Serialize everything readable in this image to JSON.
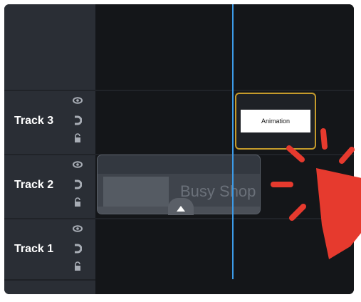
{
  "tracks": [
    {
      "label": "Track 3"
    },
    {
      "label": "Track 2"
    },
    {
      "label": "Track 1"
    }
  ],
  "media_clip": {
    "title": "Busy Shop"
  },
  "animation_clip": {
    "title": "Animation"
  },
  "colors": {
    "panel_bg": "#141619",
    "header_bg": "#2a2e35",
    "playhead": "#3c9be8",
    "clip_outline": "#c59b2c",
    "pointer": "#e63a2e"
  },
  "icons": [
    "eye-icon",
    "magnet-icon",
    "lock-icon",
    "expand-up-icon",
    "cursor-pointer-icon"
  ]
}
